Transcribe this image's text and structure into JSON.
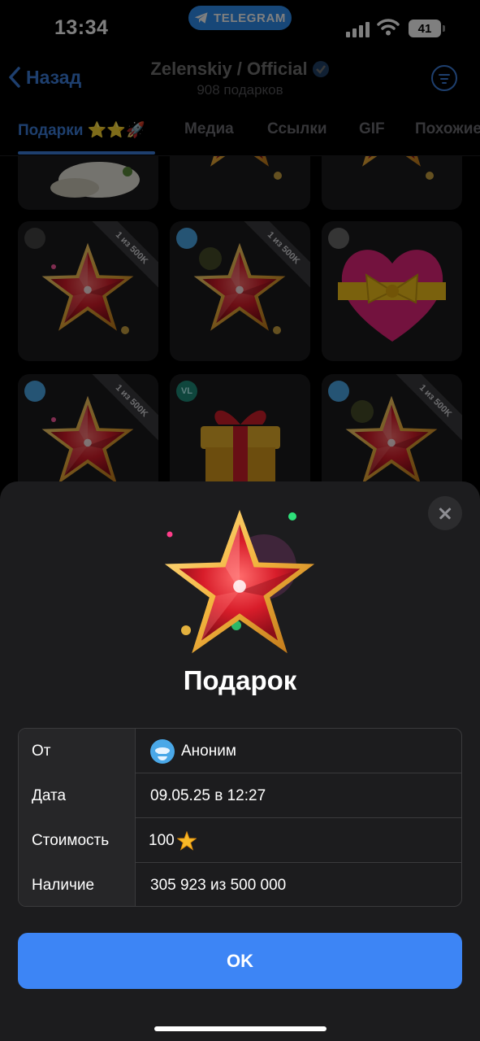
{
  "status_bar": {
    "time": "13:34",
    "app_pill": "TELEGRAM",
    "battery": "41"
  },
  "header": {
    "back_label": "Назад",
    "channel_title": "Zelenskiy / Official",
    "subtitle": "908 подарков"
  },
  "tabs": [
    {
      "label": "Подарки ⭐⭐🚀",
      "active": true
    },
    {
      "label": "Медиа"
    },
    {
      "label": "Ссылки"
    },
    {
      "label": "GIF"
    },
    {
      "label": "Похожие"
    }
  ],
  "grid": {
    "ribbon_text": "1 из 500K",
    "avatar_text_vl": "VL"
  },
  "dialog": {
    "title": "Подарок",
    "rows": [
      {
        "key": "От",
        "value": "Аноним"
      },
      {
        "key": "Дата",
        "value": "09.05.25 в 12:27"
      },
      {
        "key": "Стоимость",
        "value": "100"
      },
      {
        "key": "Наличие",
        "value": "305 923 из 500 000"
      }
    ],
    "ok_label": "OK"
  },
  "colors": {
    "accent": "#3d85f5",
    "sheet_bg": "#1c1c1e",
    "star_red": "#d81d2a",
    "star_gold": "#f2b33d"
  }
}
